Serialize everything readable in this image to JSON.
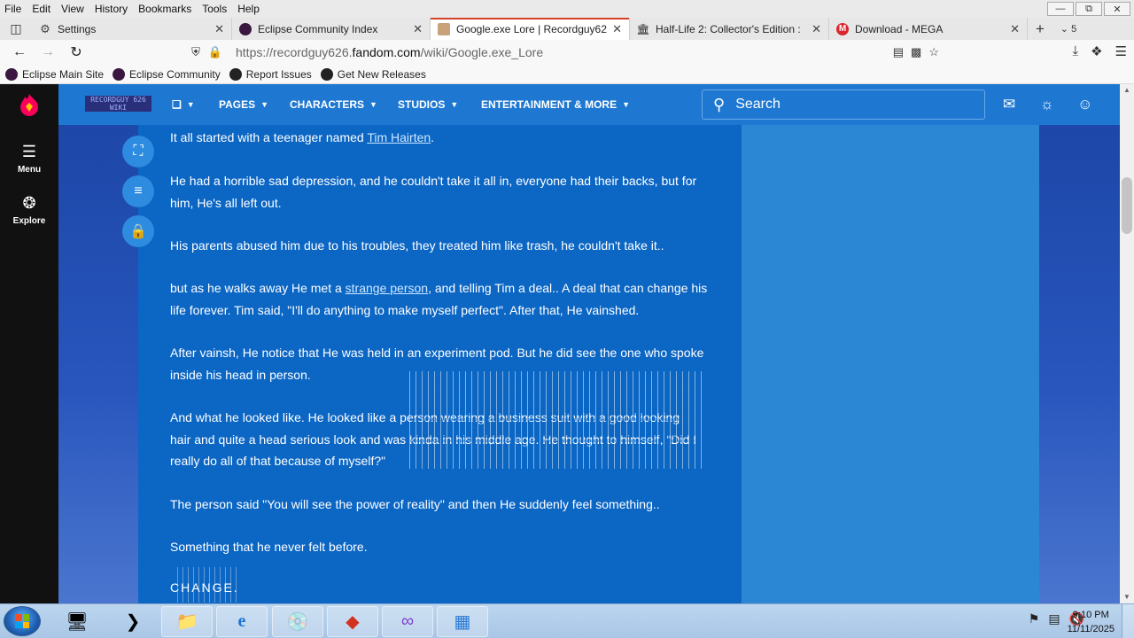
{
  "menubar": {
    "items": [
      "File",
      "Edit",
      "View",
      "History",
      "Bookmarks",
      "Tools",
      "Help"
    ]
  },
  "tabs": [
    {
      "title": "Settings",
      "icon": "gear-icon",
      "active": false
    },
    {
      "title": "Eclipse Community Index",
      "icon": "eclipse-icon",
      "active": false
    },
    {
      "title": "Google.exe Lore | Recordguy626",
      "icon": "fandom-page-icon",
      "active": true
    },
    {
      "title": "Half-Life 2: Collector's Edition : ",
      "icon": "archive-icon",
      "active": false
    },
    {
      "title": "Download - MEGA",
      "icon": "mega-icon",
      "active": false
    }
  ],
  "tab_count": "5",
  "url": {
    "prefix": "https://recordguy626.",
    "domain": "fandom.com",
    "path": "/wiki/Google.exe_Lore"
  },
  "bookmarks": [
    {
      "label": "Eclipse Main Site",
      "icon": "eclipse-icon"
    },
    {
      "label": "Eclipse Community",
      "icon": "eclipse-icon"
    },
    {
      "label": "Report Issues",
      "icon": "github-icon"
    },
    {
      "label": "Get New Releases",
      "icon": "github-icon"
    }
  ],
  "rail": {
    "menu_label": "Menu",
    "explore_label": "Explore"
  },
  "wiki": {
    "logo_text": "RECORDGUY 626 WIKI",
    "nav": [
      {
        "label": "PAGES"
      },
      {
        "label": "CHARACTERS"
      },
      {
        "label": "STUDIOS"
      },
      {
        "label": "ENTERTAINMENT & MORE"
      }
    ],
    "search_placeholder": "Search"
  },
  "article": {
    "p1_before": "It all started with a teenager named ",
    "p1_link": "Tim Hairten",
    "p1_after": ".",
    "p2": "He had a horrible sad depression, and he couldn't take it all in, everyone had their backs, but for him, He's all left out.",
    "p3": "His parents abused him due to his troubles, they treated him like trash, he couldn't take it..",
    "p4_before": "but as he walks away He met a ",
    "p4_link": "strange person",
    "p4_after": ", and telling Tim a deal.. A deal that can change his life forever. Tim said, \"I'll do anything to make myself perfect\". After that, He vainshed.",
    "p5": "After vainsh, He notice that He was held in an experiment pod. But he did see the one who spoke inside his head in person.",
    "p6": "And what he looked like. He looked like a person wearing a business suit with a good looking hair and quite a head serious look and was kinda in his middle age. He thought to himself, \"Did I really do all of that because of myself?\"",
    "p7": "The person said \"You will see the power of reality\" and then He suddenly feel something..",
    "p8": "Something that he never felt before.",
    "p9": "CHANGE."
  },
  "taskbar": {
    "apps": [
      "server-manager-icon",
      "powershell-icon",
      "file-explorer-icon",
      "internet-explorer-icon",
      "media-player-icon",
      "app-red-icon",
      "visual-studio-icon",
      "app-grid-icon"
    ],
    "time": "9:10 PM",
    "date": "11/11/2025"
  },
  "colors": {
    "article_bg": "#0b66c4",
    "wiki_header": "#1e78d2",
    "link": "#cfe9ff",
    "fandom_accent": "#fa005a"
  }
}
